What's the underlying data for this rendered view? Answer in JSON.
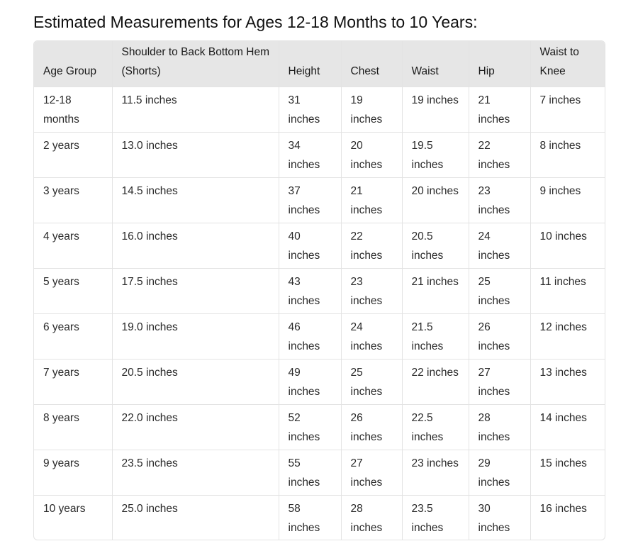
{
  "title": "Estimated Measurements for Ages 12-18 Months to 10 Years:",
  "table": {
    "headers": [
      "Age Group",
      "Shoulder to Back Bottom Hem (Shorts)",
      "Height",
      "Chest",
      "Waist",
      "Hip",
      "Waist to Knee"
    ],
    "rows": [
      [
        "12-18 months",
        "11.5 inches",
        "31 inches",
        "19 inches",
        "19 inches",
        "21 inches",
        "7 inches"
      ],
      [
        "2 years",
        "13.0 inches",
        "34 inches",
        "20 inches",
        "19.5 inches",
        "22 inches",
        "8 inches"
      ],
      [
        "3 years",
        "14.5 inches",
        "37 inches",
        "21 inches",
        "20 inches",
        "23 inches",
        "9 inches"
      ],
      [
        "4 years",
        "16.0 inches",
        "40 inches",
        "22 inches",
        "20.5 inches",
        "24 inches",
        "10 inches"
      ],
      [
        "5 years",
        "17.5 inches",
        "43 inches",
        "23 inches",
        "21 inches",
        "25 inches",
        "11 inches"
      ],
      [
        "6 years",
        "19.0 inches",
        "46 inches",
        "24 inches",
        "21.5 inches",
        "26 inches",
        "12 inches"
      ],
      [
        "7 years",
        "20.5 inches",
        "49 inches",
        "25 inches",
        "22 inches",
        "27 inches",
        "13 inches"
      ],
      [
        "8 years",
        "22.0 inches",
        "52 inches",
        "26 inches",
        "22.5 inches",
        "28 inches",
        "14 inches"
      ],
      [
        "9 years",
        "23.5 inches",
        "55 inches",
        "27 inches",
        "23 inches",
        "29 inches",
        "15 inches"
      ],
      [
        "10 years",
        "25.0 inches",
        "58 inches",
        "28 inches",
        "23.5 inches",
        "30 inches",
        "16 inches"
      ]
    ]
  },
  "colors": {
    "header_background": "#e6e6e6",
    "border": "#e3e3e3",
    "text": "#1f1f1f"
  }
}
